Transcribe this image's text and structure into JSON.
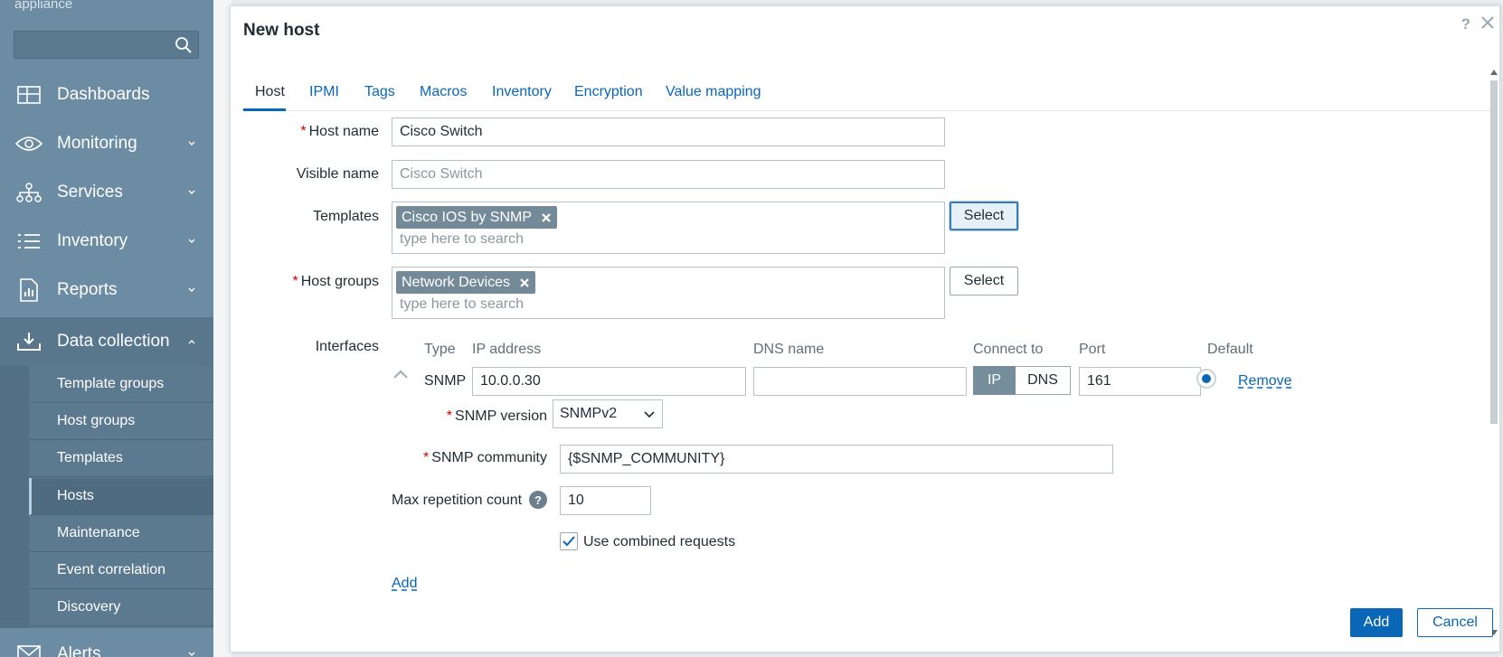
{
  "sidebar": {
    "brand_sub": "appliance",
    "search": {
      "value": "",
      "placeholder": ""
    },
    "items": [
      {
        "label": "Dashboards",
        "icon": "dashboard-icon"
      },
      {
        "label": "Monitoring",
        "icon": "eye-icon"
      },
      {
        "label": "Services",
        "icon": "hierarchy-icon"
      },
      {
        "label": "Inventory",
        "icon": "list-icon"
      },
      {
        "label": "Reports",
        "icon": "report-icon"
      },
      {
        "label": "Data collection",
        "icon": "download-icon"
      },
      {
        "label": "Alerts",
        "icon": "envelope-icon"
      }
    ],
    "submenu": [
      {
        "label": "Template groups"
      },
      {
        "label": "Host groups"
      },
      {
        "label": "Templates"
      },
      {
        "label": "Hosts"
      },
      {
        "label": "Maintenance"
      },
      {
        "label": "Event correlation"
      },
      {
        "label": "Discovery"
      }
    ]
  },
  "modal": {
    "title": "New host",
    "help": "?",
    "tabs": [
      {
        "label": "Host"
      },
      {
        "label": "IPMI"
      },
      {
        "label": "Tags"
      },
      {
        "label": "Macros"
      },
      {
        "label": "Inventory"
      },
      {
        "label": "Encryption"
      },
      {
        "label": "Value mapping"
      }
    ],
    "form": {
      "host_name": {
        "label": "Host name",
        "value": "Cisco Switch"
      },
      "visible_name": {
        "label": "Visible name",
        "value": "",
        "placeholder": "Cisco Switch"
      },
      "templates": {
        "label": "Templates",
        "chip": "Cisco IOS by SNMP",
        "placeholder": "type here to search",
        "select_label": "Select"
      },
      "host_groups": {
        "label": "Host groups",
        "chip": "Network Devices",
        "placeholder": "type here to search",
        "select_label": "Select"
      },
      "interfaces": {
        "label": "Interfaces",
        "headers": {
          "type": "Type",
          "ip": "IP address",
          "dns": "DNS name",
          "connect": "Connect to",
          "port": "Port",
          "default": "Default"
        },
        "row": {
          "type": "SNMP",
          "ip": "10.0.0.30",
          "dns": "",
          "connect_ip": "IP",
          "connect_dns": "DNS",
          "port": "161",
          "remove_label": "Remove"
        },
        "snmp_version": {
          "label": "SNMP version",
          "value": "SNMPv2"
        },
        "snmp_community": {
          "label": "SNMP community",
          "value": "{$SNMP_COMMUNITY}"
        },
        "max_repetition": {
          "label": "Max repetition count",
          "value": "10"
        },
        "combined_requests": {
          "label": "Use combined requests",
          "checked": true
        },
        "add_label": "Add"
      }
    },
    "buttons": {
      "add": "Add",
      "cancel": "Cancel"
    }
  },
  "colors": {
    "accent": "#0a66b7",
    "sidebar": "#6c8ca3",
    "required": "#d40000"
  }
}
